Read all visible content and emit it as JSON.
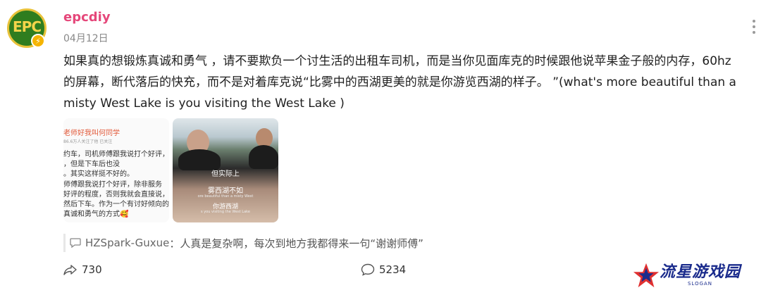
{
  "post": {
    "avatar_text": "EPC",
    "username": "epcdiy",
    "date": "04月12日",
    "text": "如果真的想锻炼真诚和勇气 ，请不要欺负一个讨生活的出租车司机，而是当你见面库克的时候跟他说苹果金子般的内存，60hz的屏幕，断代落后的快充，而不是对着库克说“比雾中的西湖更美的就是你游览西湖的样子。 ”(what's more beautiful than a misty West Lake is you visiting the West Lake )"
  },
  "images": {
    "screenshot": {
      "header": "老师好我叫何同学",
      "followers": "86.6万人关注了他  已关注",
      "lines": [
        "约车，司机师傅跟我说打个好评，",
        "，但是下车后也没",
        "。其实这样挺不好的。",
        "师傅跟我说打个好评，除非服务",
        "好评的程度，否则我就会直接说，",
        "然后下车。作为一个有讨好倾向的",
        "真诚和勇气的方式🥰"
      ]
    },
    "video": {
      "caption1": "但实际上",
      "caption2": "雾西湖不如",
      "caption2_en": "ore beautiful than a misty West",
      "caption3": "你游西湖",
      "caption3_en": "s you visiting the West Lake"
    }
  },
  "top_comment": {
    "author": "HZSpark-Guxue",
    "separator": "：",
    "text": "人真是复杂啊，每次到地方我都得来一句“谢谢师傅”"
  },
  "stats": {
    "shares": "730",
    "comments": "5234"
  },
  "watermark": {
    "title": "流星游戏园",
    "slogan": "SLOGAN"
  },
  "colors": {
    "username": "#e5477a",
    "avatar_bg": "#2f7d1f",
    "watermark": "#1a2b8c"
  },
  "icons": [
    "more-vertical-icon",
    "verified-badge-icon",
    "comment-bubble-icon",
    "share-icon",
    "comment-icon",
    "star-logo-icon"
  ]
}
